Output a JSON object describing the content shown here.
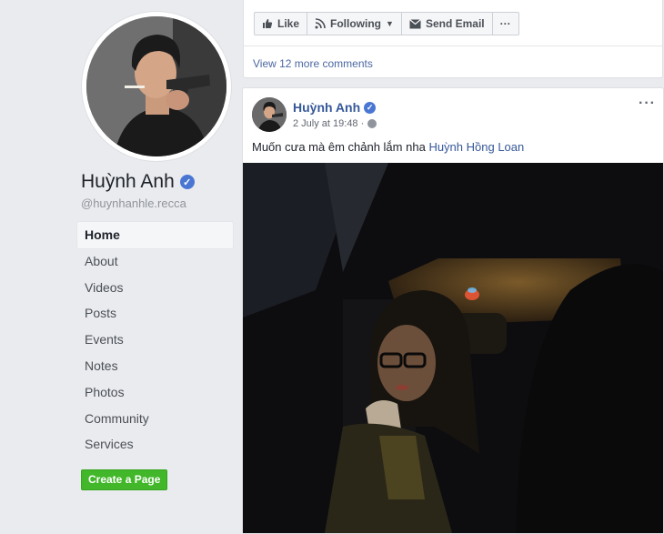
{
  "profile": {
    "name": "Huỳnh Anh",
    "handle": "@huynhanhle.recca",
    "nav": [
      {
        "label": "Home",
        "active": true
      },
      {
        "label": "About"
      },
      {
        "label": "Videos"
      },
      {
        "label": "Posts"
      },
      {
        "label": "Events"
      },
      {
        "label": "Notes"
      },
      {
        "label": "Photos"
      },
      {
        "label": "Community"
      },
      {
        "label": "Services"
      }
    ],
    "create_page_label": "Create a Page"
  },
  "top_card": {
    "like_label": "Like",
    "following_label": "Following",
    "send_email_label": "Send Email",
    "more_label": "···",
    "view_comments": "View 12 more comments"
  },
  "post": {
    "author": "Huỳnh Anh",
    "timestamp": "2 July at 19:48 ·",
    "menu_label": "···",
    "text": "Muốn cưa mà êm chảnh lắm nha",
    "mention": "Huỳnh Hồng Loan"
  },
  "colors": {
    "background": "#e9ebee",
    "link": "#365899",
    "create_button": "#42b72a",
    "verified": "#4a76d3"
  }
}
